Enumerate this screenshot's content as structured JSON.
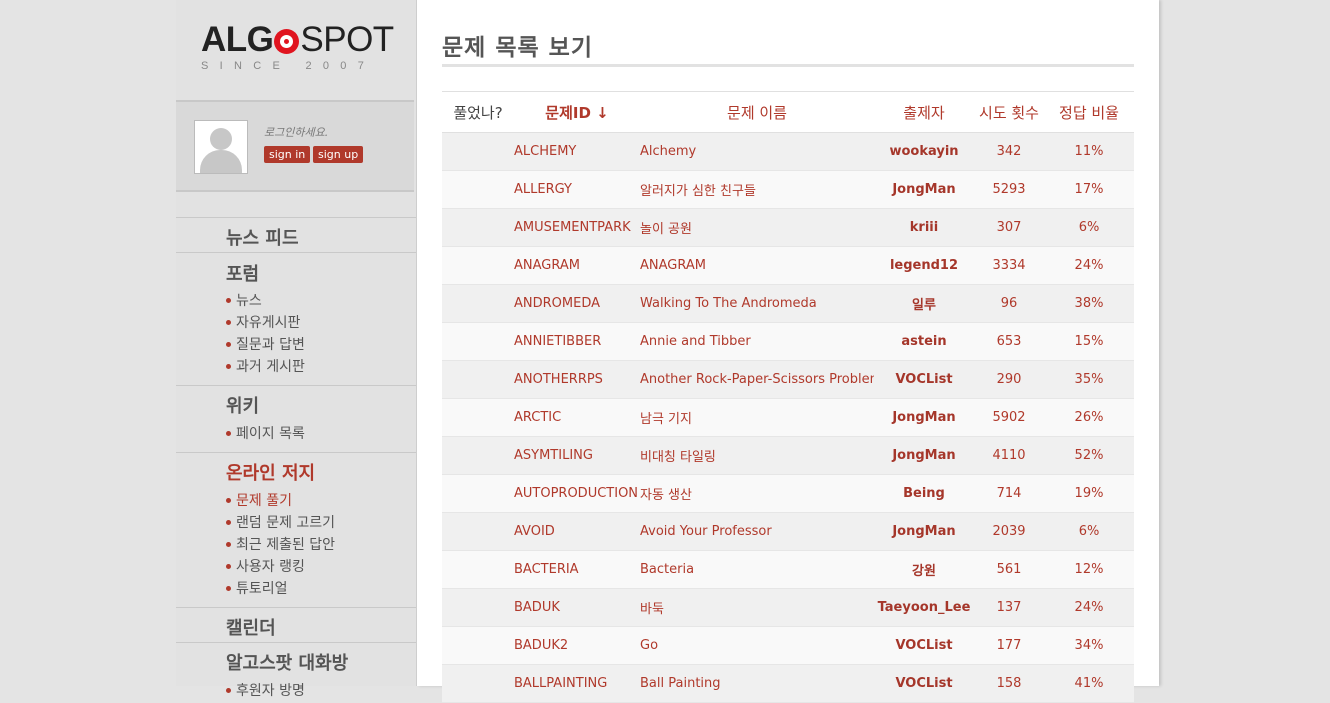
{
  "logo": {
    "algo": "ALG",
    "spot": "SPOT",
    "since": "SINCE 2007"
  },
  "login": {
    "message": "로그인하세요.",
    "signin_label": "sign in",
    "signup_label": "sign up"
  },
  "nav": {
    "news_feed": "뉴스 피드",
    "forum": {
      "title": "포럼",
      "items": [
        "뉴스",
        "자유게시판",
        "질문과 답변",
        "과거 게시판"
      ]
    },
    "wiki": {
      "title": "위키",
      "items": [
        "페이지 목록"
      ]
    },
    "judge": {
      "title": "온라인 저지",
      "items": [
        "문제 풀기",
        "랜덤 문제 고르기",
        "최근 제출된 답안",
        "사용자 랭킹",
        "튜토리얼"
      ]
    },
    "calendar": "캘린더",
    "chat": {
      "title": "알고스팟 대화방",
      "items": [
        "후원자 방명"
      ]
    }
  },
  "page_title": "문제 목록 보기",
  "table": {
    "headers": {
      "solved": "풀었나?",
      "id": "문제ID ↓",
      "name": "문제 이름",
      "author": "출제자",
      "tries": "시도 횟수",
      "ratio": "정답 비율"
    },
    "rows": [
      {
        "id": "ALCHEMY",
        "name": "Alchemy",
        "author": "wookayin",
        "tries": "342",
        "ratio": "11%"
      },
      {
        "id": "ALLERGY",
        "name": "알러지가 심한 친구들",
        "author": "JongMan",
        "tries": "5293",
        "ratio": "17%"
      },
      {
        "id": "AMUSEMENTPARK",
        "name": "놀이 공원",
        "author": "kriii",
        "tries": "307",
        "ratio": "6%"
      },
      {
        "id": "ANAGRAM",
        "name": "ANAGRAM",
        "author": "legend12",
        "tries": "3334",
        "ratio": "24%"
      },
      {
        "id": "ANDROMEDA",
        "name": "Walking To The Andromeda",
        "author": "일루",
        "tries": "96",
        "ratio": "38%"
      },
      {
        "id": "ANNIETIBBER",
        "name": "Annie and Tibber",
        "author": "astein",
        "tries": "653",
        "ratio": "15%"
      },
      {
        "id": "ANOTHERRPS",
        "name": "Another Rock-Paper-Scissors Problem",
        "author": "VOCList",
        "tries": "290",
        "ratio": "35%"
      },
      {
        "id": "ARCTIC",
        "name": "남극 기지",
        "author": "JongMan",
        "tries": "5902",
        "ratio": "26%"
      },
      {
        "id": "ASYMTILING",
        "name": "비대칭 타일링",
        "author": "JongMan",
        "tries": "4110",
        "ratio": "52%"
      },
      {
        "id": "AUTOPRODUCTION",
        "name": "자동 생산",
        "author": "Being",
        "tries": "714",
        "ratio": "19%"
      },
      {
        "id": "AVOID",
        "name": "Avoid Your Professor",
        "author": "JongMan",
        "tries": "2039",
        "ratio": "6%"
      },
      {
        "id": "BACTERIA",
        "name": "Bacteria",
        "author": "강원",
        "tries": "561",
        "ratio": "12%"
      },
      {
        "id": "BADUK",
        "name": "바둑",
        "author": "Taeyoon_Lee",
        "tries": "137",
        "ratio": "24%"
      },
      {
        "id": "BADUK2",
        "name": "Go",
        "author": "VOCList",
        "tries": "177",
        "ratio": "34%"
      },
      {
        "id": "BALLPAINTING",
        "name": "Ball Painting",
        "author": "VOCList",
        "tries": "158",
        "ratio": "41%"
      }
    ]
  },
  "colors": {
    "accent": "#b0392b",
    "logo_red": "#e0141f"
  }
}
